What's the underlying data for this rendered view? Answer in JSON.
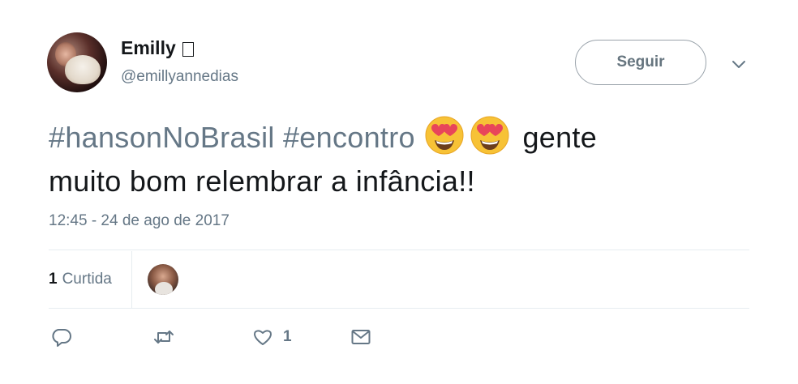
{
  "author": {
    "display_name": "Emilly",
    "handle": "@emillyannedias",
    "follow_label": "Seguir"
  },
  "tweet": {
    "hashtag1": "#hansonNoBrasil",
    "hashtag2": "#encontro",
    "text_after_emoji": "gente",
    "text_line2": "muito bom relembrar a infância!!",
    "emoji": "smiling-face-with-heart-eyes",
    "timestamp": "12:45 - 24 de ago de 2017"
  },
  "stats": {
    "likes_count": "1",
    "likes_label": "Curtida"
  },
  "actions": {
    "like_count": "1"
  },
  "colors": {
    "text": "#14171a",
    "secondary": "#657786",
    "divider": "#e6ecf0"
  }
}
